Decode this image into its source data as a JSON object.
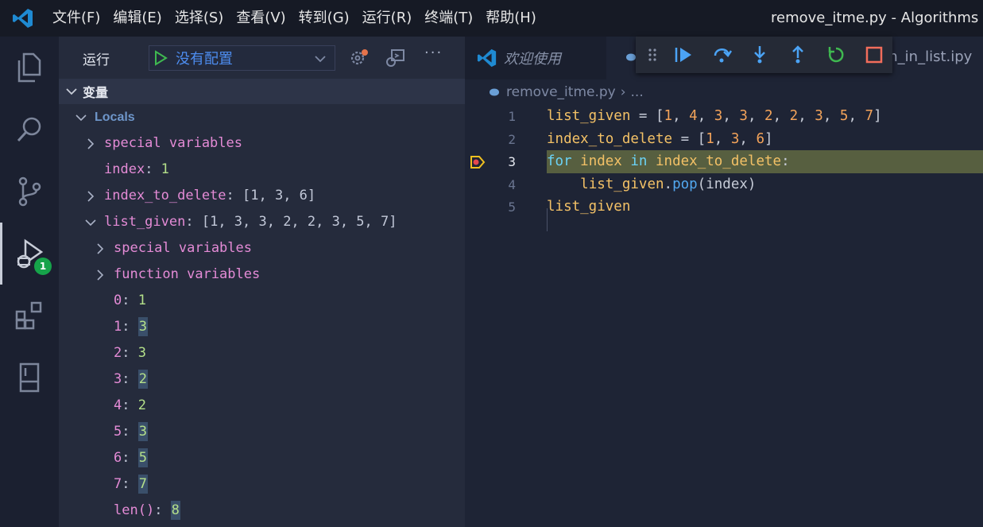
{
  "titlebar": {
    "menu": [
      "文件(F)",
      "编辑(E)",
      "选择(S)",
      "查看(V)",
      "转到(G)",
      "运行(R)",
      "终端(T)",
      "帮助(H)"
    ],
    "window_title": "remove_itme.py - Algorithms - Vis"
  },
  "activitybar": {
    "items": [
      "files-icon",
      "search-icon",
      "source-control-icon",
      "run-debug-icon",
      "extensions-icon",
      "notebook-icon"
    ],
    "debug_badge": "1"
  },
  "sidebar": {
    "run_label": "运行",
    "config_value": "没有配置",
    "more_label": "···",
    "section_title": "变量",
    "locals_label": "Locals",
    "rows": [
      {
        "key": "special variables",
        "value": "",
        "twistie": "collapsed"
      },
      {
        "key": "index",
        "value": "1",
        "twistie": "none"
      },
      {
        "key": "index_to_delete",
        "value": "[1, 3, 6]",
        "twistie": "collapsed"
      },
      {
        "key": "list_given",
        "value": "[1, 3, 3, 2, 2, 3, 5, 7]",
        "twistie": "expanded"
      },
      {
        "key": "special variables",
        "value": "",
        "twistie": "collapsed"
      },
      {
        "key": "function variables",
        "value": "",
        "twistie": "collapsed"
      },
      {
        "key": "0",
        "value": "1",
        "twistie": "none",
        "changed": false
      },
      {
        "key": "1",
        "value": "3",
        "twistie": "none",
        "changed": true
      },
      {
        "key": "2",
        "value": "3",
        "twistie": "none",
        "changed": false
      },
      {
        "key": "3",
        "value": "2",
        "twistie": "none",
        "changed": true
      },
      {
        "key": "4",
        "value": "2",
        "twistie": "none",
        "changed": false
      },
      {
        "key": "5",
        "value": "3",
        "twistie": "none",
        "changed": true
      },
      {
        "key": "6",
        "value": "5",
        "twistie": "none",
        "changed": true
      },
      {
        "key": "7",
        "value": "7",
        "twistie": "none",
        "changed": true
      },
      {
        "key": "len()",
        "value": "8",
        "twistie": "none",
        "changed": true
      }
    ]
  },
  "editor": {
    "tab_welcome": "欢迎使用",
    "tab_other": "tem_in_list.ipy",
    "breadcrumb_file": "remove_itme.py",
    "breadcrumb_sep": "›",
    "breadcrumb_more": "...",
    "current_line": 3,
    "lines": [
      {
        "num": "1",
        "tokens": [
          [
            "var",
            "list_given"
          ],
          [
            "pun",
            " = ["
          ],
          [
            "num",
            "1"
          ],
          [
            "pun",
            ", "
          ],
          [
            "num",
            "4"
          ],
          [
            "pun",
            ", "
          ],
          [
            "num",
            "3"
          ],
          [
            "pun",
            ", "
          ],
          [
            "num",
            "3"
          ],
          [
            "pun",
            ", "
          ],
          [
            "num",
            "2"
          ],
          [
            "pun",
            ", "
          ],
          [
            "num",
            "2"
          ],
          [
            "pun",
            ", "
          ],
          [
            "num",
            "3"
          ],
          [
            "pun",
            ", "
          ],
          [
            "num",
            "5"
          ],
          [
            "pun",
            ", "
          ],
          [
            "num",
            "7"
          ],
          [
            "pun",
            "]"
          ]
        ]
      },
      {
        "num": "2",
        "tokens": [
          [
            "var",
            "index_to_delete"
          ],
          [
            "pun",
            " = ["
          ],
          [
            "num",
            "1"
          ],
          [
            "pun",
            ", "
          ],
          [
            "num",
            "3"
          ],
          [
            "pun",
            ", "
          ],
          [
            "num",
            "6"
          ],
          [
            "pun",
            "]"
          ]
        ]
      },
      {
        "num": "3",
        "tokens": [
          [
            "kw",
            "for"
          ],
          [
            "pun",
            " "
          ],
          [
            "var",
            "index"
          ],
          [
            "pun",
            " "
          ],
          [
            "kw",
            "in"
          ],
          [
            "pun",
            " "
          ],
          [
            "var",
            "index_to_delete"
          ],
          [
            "pun",
            ":"
          ]
        ]
      },
      {
        "num": "4",
        "tokens": [
          [
            "pun",
            "    "
          ],
          [
            "var",
            "list_given"
          ],
          [
            "pun",
            "."
          ],
          [
            "fn",
            "pop"
          ],
          [
            "pun",
            "(index)"
          ]
        ]
      },
      {
        "num": "5",
        "tokens": [
          [
            "var",
            "list_given"
          ]
        ]
      }
    ]
  },
  "debug_toolbar": [
    "continue-icon",
    "step-over-icon",
    "step-into-icon",
    "step-out-icon",
    "restart-icon",
    "stop-icon"
  ],
  "colors": {
    "accent": "#4d8df0",
    "badge": "#16a34a",
    "current_line": "#575f40",
    "breakpoint": "#f0c020"
  }
}
